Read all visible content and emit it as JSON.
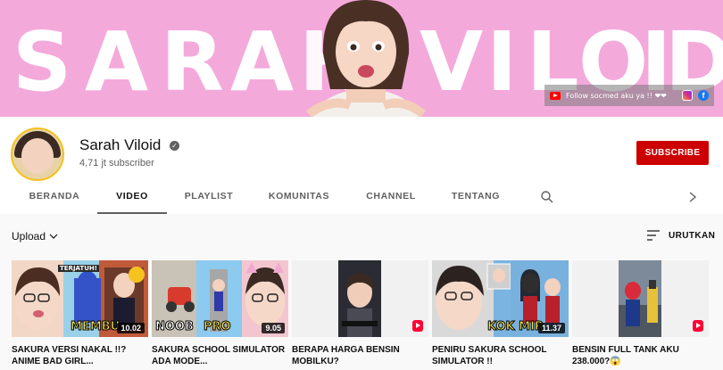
{
  "banner": {
    "letters": [
      "S",
      "A",
      "R",
      "A",
      "H",
      "V",
      "I",
      "L",
      "O",
      "I",
      "D"
    ],
    "social_text": "Follow socmed aku ya !! ❤❤",
    "bg_color": "#f4a9db"
  },
  "channel": {
    "name": "Sarah Viloid",
    "verified_glyph": "✓",
    "subscribers": "4,71 jt subscriber",
    "subscribe_label": "SUBSCRIBE",
    "subscribe_color": "#cc0000"
  },
  "tabs": [
    {
      "label": "BERANDA"
    },
    {
      "label": "VIDEO",
      "active": true
    },
    {
      "label": "PLAYLIST"
    },
    {
      "label": "KOMUNITAS"
    },
    {
      "label": "CHANNEL"
    },
    {
      "label": "TENTANG"
    }
  ],
  "toolbar": {
    "upload_label": "Upload",
    "sort_label": "URUTKAN"
  },
  "videos": [
    {
      "title": "SAKURA VERSI NAKAL !!? ANIME BAD GIRL...",
      "duration": "10.02",
      "overlay": "MEMBU",
      "tag": "TERJATUH!",
      "icon": "emoji-grin-icon"
    },
    {
      "title": "SAKURA SCHOOL SIMULATOR ADA MODE...",
      "duration": "9.05",
      "overlay": "NOOB",
      "overlay2": "PRO",
      "icon": "cat-ears-icon"
    },
    {
      "title": "BERAPA HARGA BENSIN MOBILKU?",
      "duration": "",
      "shorts": true,
      "icon": "shorts-icon"
    },
    {
      "title": "PENIRU SAKURA SCHOOL SIMULATOR !!",
      "duration": "11.37",
      "overlay": "KOK MIR",
      "icon": "anime-icon"
    },
    {
      "title": "BENSIN FULL TANK AKU 238.000?😱",
      "duration": "",
      "shorts": true,
      "icon": "shorts-icon"
    }
  ]
}
